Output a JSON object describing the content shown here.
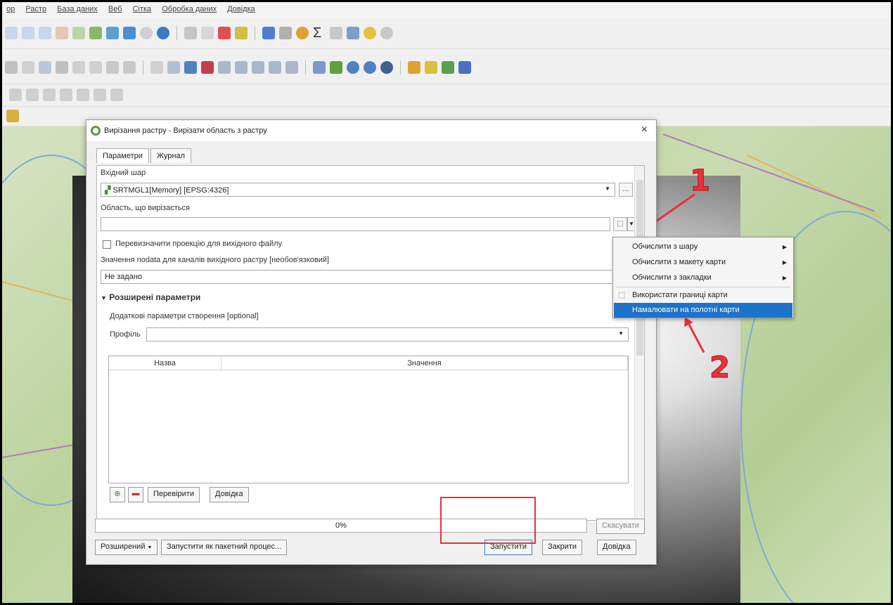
{
  "menubar": [
    "ор",
    "Растр",
    "База даних",
    "Веб",
    "Сітка",
    "Обробка даних",
    "Довідка"
  ],
  "dialog": {
    "title": "Вирізання растру - Вирізати область з растру",
    "close": "×",
    "tabs": [
      "Параметри",
      "Журнал"
    ],
    "input_layer_label": "Вхідний шар",
    "input_layer_value": "SRTMGL1[Memory] [EPSG:4326]",
    "extent_label": "Область, що вирізається",
    "extent_value": "",
    "override_projection_label": "Перевизначити проекцію для вихідного файлу",
    "nodata_label": "Значення nodata для каналів вихідного растру [необов'язковий]",
    "nodata_value": "Не задано",
    "advanced_label": "Розширені параметри",
    "creation_options_label": "Додаткові параметри створення [optional]",
    "profile_label": "Профіль",
    "table_headers": [
      "Назва",
      "Значення"
    ],
    "validate_label": "Перевірити",
    "help_small_label": "Довідка",
    "progress_text": "0%",
    "cancel_label": "Скасувати",
    "advanced_btn": "Розширений",
    "batch_label": "Запустити як пакетний процес...",
    "run_label": "Запустити",
    "close_label": "Закрити",
    "help_label": "Довідка"
  },
  "extent_menu": {
    "items": [
      {
        "label": "Обчислити з шару",
        "has_submenu": true
      },
      {
        "label": "Обчислити з макету карти",
        "has_submenu": true
      },
      {
        "label": "Обчислити з закладки",
        "has_submenu": true
      },
      {
        "label": "Використати границі карти",
        "has_submenu": false
      },
      {
        "label": "Намалювати на полотні карти",
        "has_submenu": false,
        "selected": true
      }
    ]
  },
  "annotations": {
    "marker1": "1",
    "marker2": "2"
  },
  "colors": {
    "accent": "#1d73c9",
    "annotation": "#e8323c",
    "qgis_green": "#5a9b3a"
  }
}
